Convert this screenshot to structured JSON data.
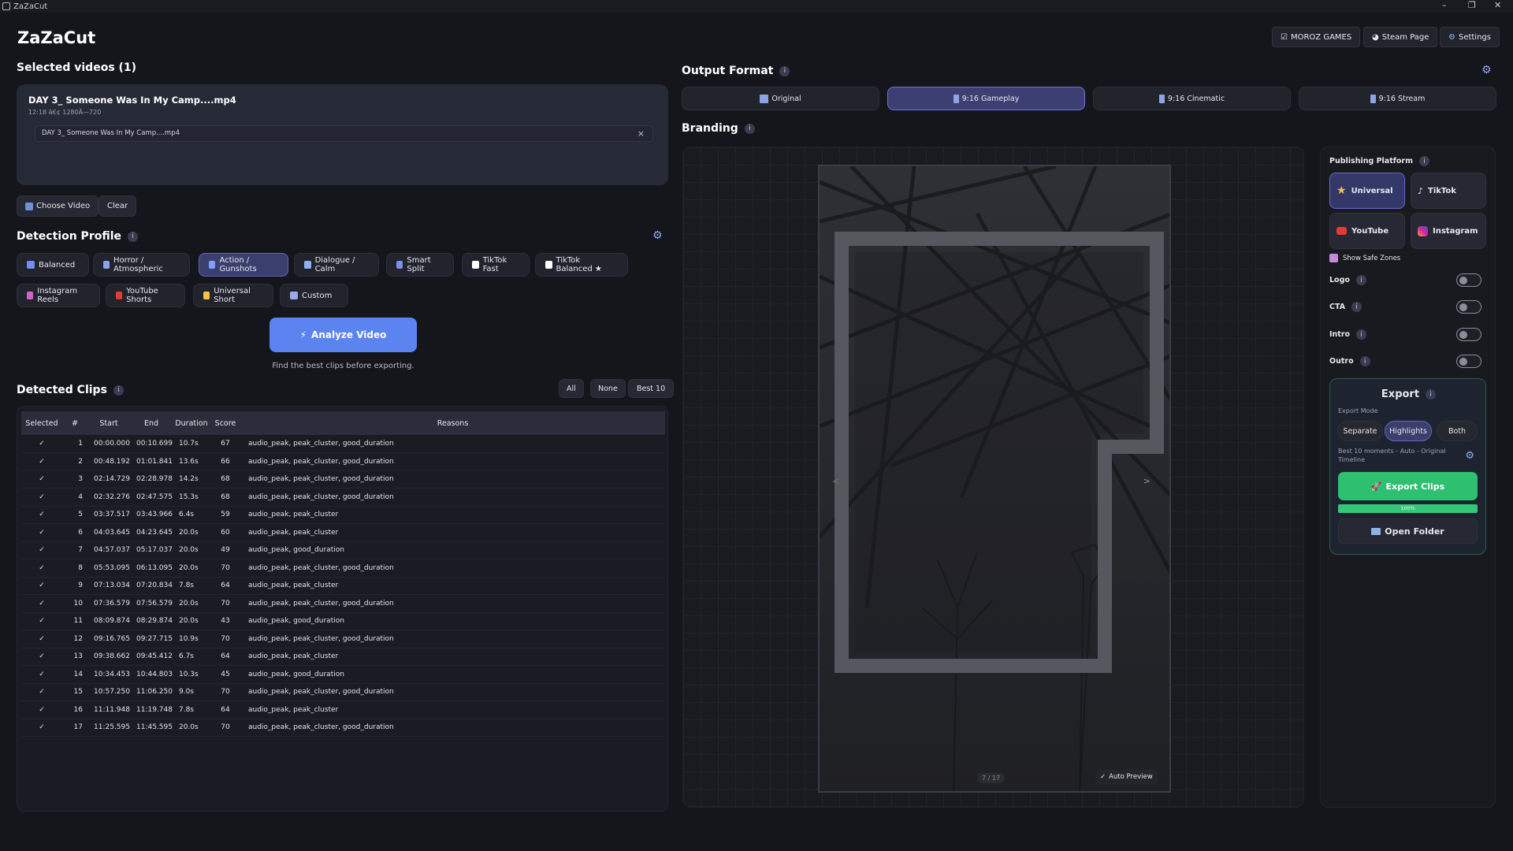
{
  "window": {
    "title": "ZaZaCut",
    "minimize": "–",
    "restore": "❐",
    "close": "✕"
  },
  "app": {
    "title": "ZaZaCut"
  },
  "topbar": {
    "moroz": "MOROZ GAMES",
    "steam": "Steam Page",
    "settings": "Settings"
  },
  "selected": {
    "heading": "Selected videos (1)",
    "video_title": "DAY 3_ Someone Was In My Camp....mp4",
    "video_meta": "12:18 â€¢ 1280Ã—720",
    "file_item": "DAY 3_ Someone Was In My Camp....mp4",
    "remove": "×",
    "choose": "Choose Video",
    "clear": "Clear"
  },
  "detection": {
    "heading": "Detection Profile",
    "profiles": [
      {
        "label": "Balanced",
        "color": "#6f8ff0"
      },
      {
        "label": "Horror / Atmospheric",
        "color": "#8aa2e8"
      },
      {
        "label": "Action / Gunshots",
        "color": "#7fa0ff"
      },
      {
        "label": "Dialogue / Calm",
        "color": "#8fb0f0"
      },
      {
        "label": "Smart Split",
        "color": "#7d8fe0"
      },
      {
        "label": "TikTok Fast",
        "color": "#ffffff"
      },
      {
        "label": "TikTok Balanced ★",
        "color": "#ffffff"
      },
      {
        "label": "Instagram Reels",
        "color": "#d262c8"
      },
      {
        "label": "YouTube Shorts",
        "color": "#e53935"
      },
      {
        "label": "Universal Short",
        "color": "#f5c242"
      },
      {
        "label": "Custom",
        "color": "#9aaae8"
      }
    ],
    "active_profile": "Action / Gunshots",
    "analyze": "Analyze Video",
    "analyze_hint": "Find the best clips before exporting."
  },
  "clips": {
    "heading": "Detected Clips",
    "filters": {
      "all": "All",
      "none": "None",
      "best": "Best 10"
    },
    "columns": [
      "Selected",
      "#",
      "Start",
      "End",
      "Duration",
      "Score",
      "Reasons"
    ],
    "rows": [
      [
        "✓",
        "1",
        "00:00.000",
        "00:10.699",
        "10.7s",
        "67",
        "audio_peak, peak_cluster, good_duration"
      ],
      [
        "✓",
        "2",
        "00:48.192",
        "01:01.841",
        "13.6s",
        "66",
        "audio_peak, peak_cluster, good_duration"
      ],
      [
        "✓",
        "3",
        "02:14.729",
        "02:28.978",
        "14.2s",
        "68",
        "audio_peak, peak_cluster, good_duration"
      ],
      [
        "✓",
        "4",
        "02:32.276",
        "02:47.575",
        "15.3s",
        "68",
        "audio_peak, peak_cluster, good_duration"
      ],
      [
        "✓",
        "5",
        "03:37.517",
        "03:43.966",
        "6.4s",
        "59",
        "audio_peak, peak_cluster"
      ],
      [
        "✓",
        "6",
        "04:03.645",
        "04:23.645",
        "20.0s",
        "60",
        "audio_peak, peak_cluster"
      ],
      [
        "✓",
        "7",
        "04:57.037",
        "05:17.037",
        "20.0s",
        "49",
        "audio_peak, good_duration"
      ],
      [
        "✓",
        "8",
        "05:53.095",
        "06:13.095",
        "20.0s",
        "70",
        "audio_peak, peak_cluster, good_duration"
      ],
      [
        "✓",
        "9",
        "07:13.034",
        "07:20.834",
        "7.8s",
        "64",
        "audio_peak, peak_cluster"
      ],
      [
        "✓",
        "10",
        "07:36.579",
        "07:56.579",
        "20.0s",
        "70",
        "audio_peak, peak_cluster, good_duration"
      ],
      [
        "✓",
        "11",
        "08:09.874",
        "08:29.874",
        "20.0s",
        "43",
        "audio_peak, good_duration"
      ],
      [
        "✓",
        "12",
        "09:16.765",
        "09:27.715",
        "10.9s",
        "70",
        "audio_peak, peak_cluster, good_duration"
      ],
      [
        "✓",
        "13",
        "09:38.662",
        "09:45.412",
        "6.7s",
        "64",
        "audio_peak, peak_cluster"
      ],
      [
        "✓",
        "14",
        "10:34.453",
        "10:44.803",
        "10.3s",
        "45",
        "audio_peak, good_duration"
      ],
      [
        "✓",
        "15",
        "10:57.250",
        "11:06.250",
        "9.0s",
        "70",
        "audio_peak, peak_cluster, good_duration"
      ],
      [
        "✓",
        "16",
        "11:11.948",
        "11:19.748",
        "7.8s",
        "64",
        "audio_peak, peak_cluster"
      ],
      [
        "✓",
        "17",
        "11:25.595",
        "11:45.595",
        "20.0s",
        "70",
        "audio_peak, peak_cluster, good_duration"
      ]
    ]
  },
  "output": {
    "heading": "Output Format",
    "formats": [
      "Original",
      "9:16 Gameplay",
      "9:16 Cinematic",
      "9:16 Stream"
    ],
    "active_format": "9:16 Gameplay"
  },
  "branding": {
    "heading": "Branding",
    "preview_counter": "7 / 17",
    "auto_preview": "Auto Preview",
    "prev": "<",
    "next": ">"
  },
  "publishing": {
    "heading": "Publishing Platform",
    "platforms": [
      "Universal",
      "TikTok",
      "YouTube",
      "Instagram"
    ],
    "active": "Universal",
    "safe_zones": "Show Safe Zones",
    "toggles": [
      "Logo",
      "CTA",
      "Intro",
      "Outro"
    ]
  },
  "export": {
    "heading": "Export",
    "mode_label": "Export Mode",
    "modes": [
      "Separate",
      "Highlights",
      "Both"
    ],
    "active_mode": "Highlights",
    "summary": "Best 10 moments - Auto - Original Timeline",
    "export_button": "Export Clips",
    "progress": 1.0,
    "progress_label": "100%",
    "open_folder": "Open Folder"
  },
  "colors": {
    "accent": "#5b84f0",
    "export_green": "#2fbf71",
    "active_chip": "#3b3f6e"
  }
}
